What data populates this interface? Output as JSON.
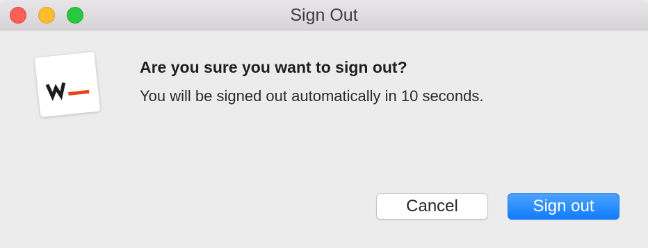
{
  "window": {
    "title": "Sign Out"
  },
  "traffic_lights": {
    "close_color": "#fd5f57",
    "minimize_color": "#febc2e",
    "zoom_color": "#28c840"
  },
  "app_icon": {
    "name": "w-logo-icon",
    "accent_color": "#e8451e"
  },
  "dialog": {
    "heading": "Are you sure you want to sign out?",
    "message": "You will be signed out automatically in 10 seconds."
  },
  "buttons": {
    "cancel_label": "Cancel",
    "sign_out_label": "Sign out",
    "primary_color": "#1a7cf2"
  }
}
